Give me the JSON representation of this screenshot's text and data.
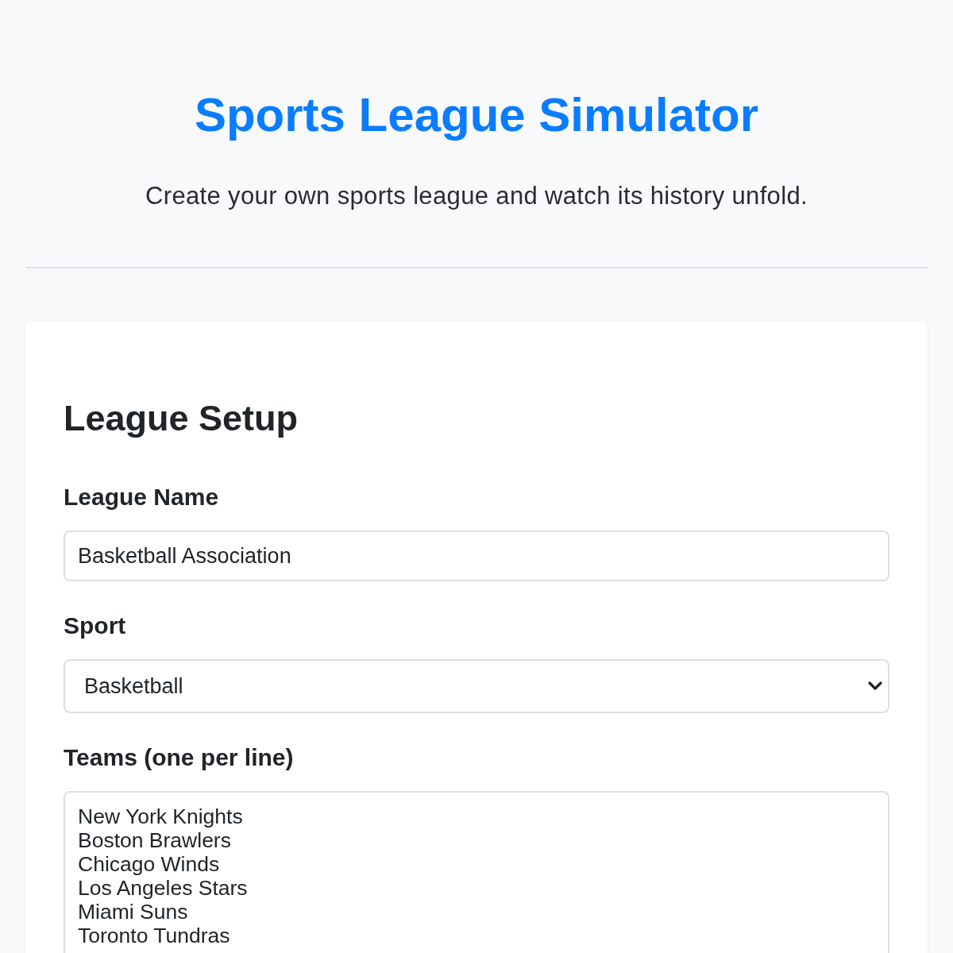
{
  "header": {
    "title": "Sports League Simulator",
    "subtitle": "Create your own sports league and watch its history unfold."
  },
  "setup": {
    "heading": "League Setup",
    "fields": [
      {
        "kind": "text",
        "label": "League Name",
        "value": "Basketball Association"
      },
      {
        "kind": "select",
        "label": "Sport",
        "value": "Basketball"
      },
      {
        "kind": "textarea",
        "label": "Teams (one per line)",
        "lines": [
          "New York Knights",
          "Boston Brawlers",
          "Chicago Winds",
          "Los Angeles Stars",
          "Miami Suns",
          "Toronto Tundras"
        ]
      }
    ]
  }
}
